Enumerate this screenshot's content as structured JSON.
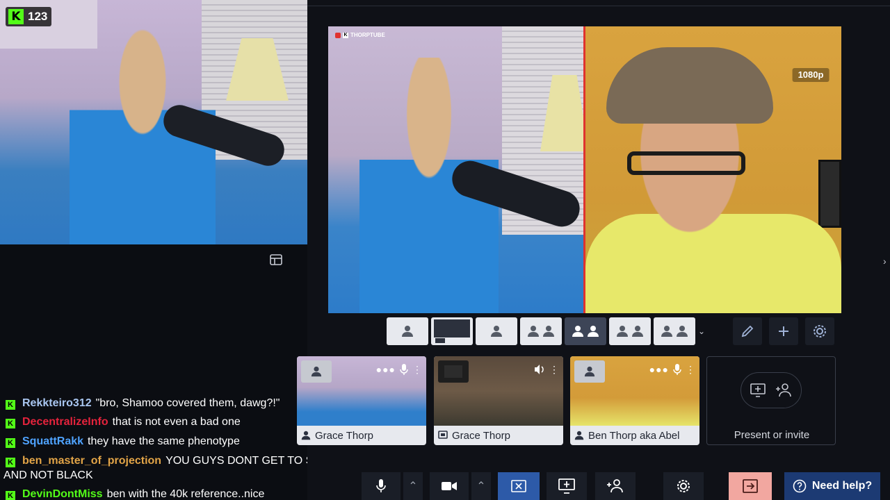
{
  "viewer_badge": {
    "platform_letter": "K",
    "count": "123"
  },
  "chat": {
    "messages": [
      {
        "user": "Rekkteiro312",
        "color": "#a9c6f0",
        "text": "\"bro, Shamoo covered them, dawg?!\""
      },
      {
        "user": "DecentralizeInfo",
        "color": "#e5233c",
        "text": "that is not even a bad one"
      },
      {
        "user": "SquattRakk",
        "color": "#4fa3ff",
        "text": "they have the same phenotype"
      },
      {
        "user": "ben_master_of_projection",
        "color": "#e2a447",
        "text": "YOU GUYS DONT GET TO SAY WHO IS BLACK",
        "continuation": "AND NOT BLACK"
      },
      {
        "user": "DevinDontMiss",
        "color": "#53fc18",
        "text": "ben with the 40k reference..nice"
      }
    ]
  },
  "stage": {
    "brand": "THORPTUBE",
    "resolution": "1080p",
    "divider_color": "#e0322f"
  },
  "participants": [
    {
      "name": "Grace Thorp",
      "source": "camera"
    },
    {
      "name": "Grace Thorp",
      "source": "screen"
    },
    {
      "name": "Ben Thorp aka Abel",
      "source": "camera"
    }
  ],
  "present_invite": {
    "label": "Present or invite"
  },
  "help": {
    "label": "Need help?"
  },
  "colors": {
    "kick_green": "#53fc18",
    "accent_blue": "#2d5aa8",
    "leave_pink": "#f2a7a0"
  }
}
